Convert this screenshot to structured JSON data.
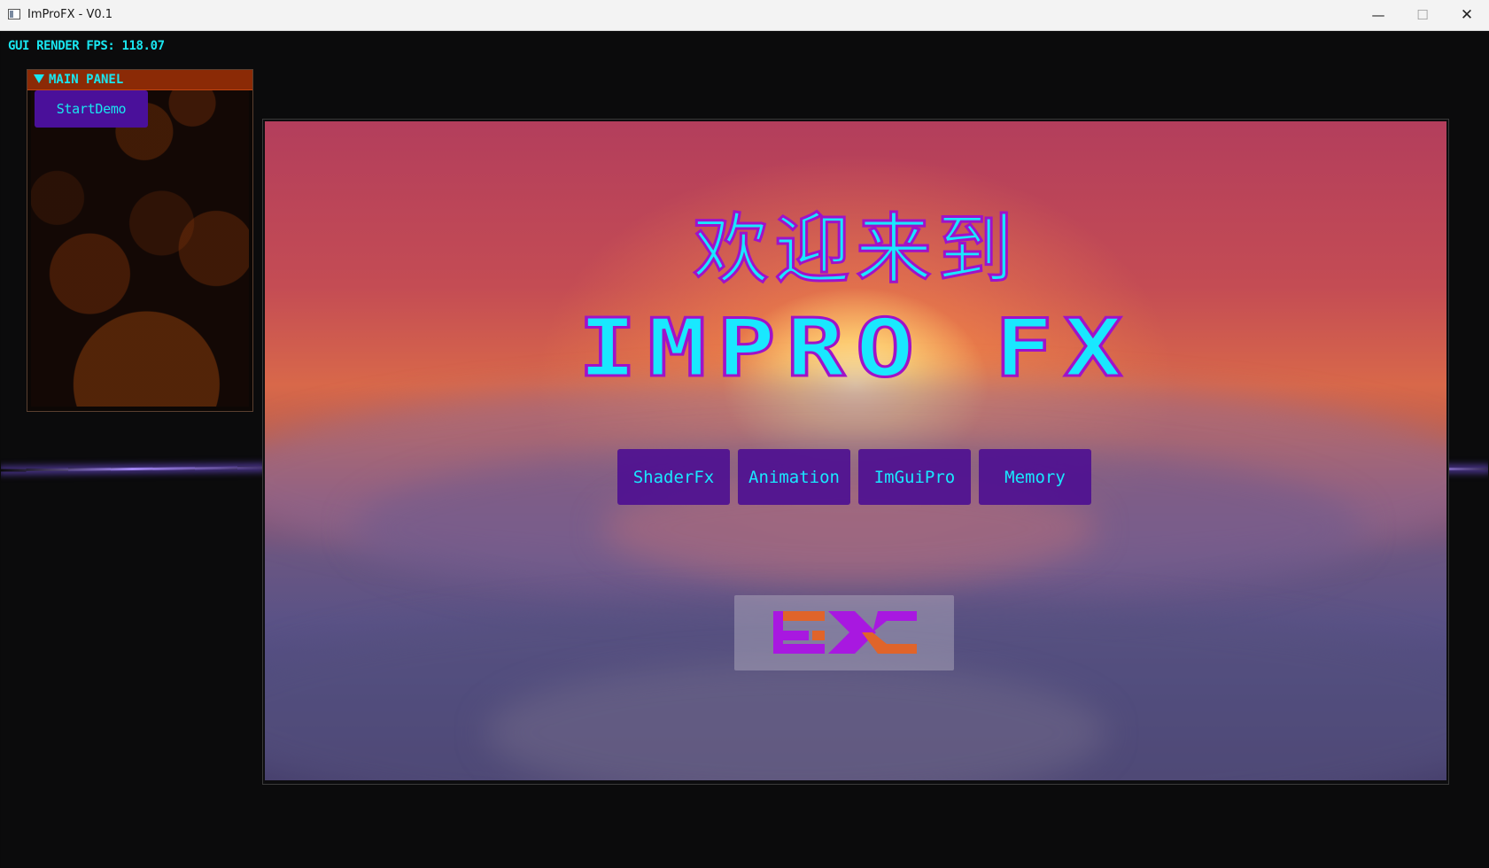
{
  "window": {
    "title": "ImProFX - V0.1",
    "minimize_label": "—",
    "maximize_label": "☐",
    "close_label": "✕"
  },
  "overlay": {
    "fps_text": "GUI RENDER FPS: 118.07"
  },
  "main_panel": {
    "title": "MAIN PANEL",
    "start_button_label": "StartDemo"
  },
  "viewport": {
    "welcome_text": "欢迎来到",
    "logo_text": "IMPRO FX",
    "nav_buttons": [
      {
        "label": "ShaderFx"
      },
      {
        "label": "Animation"
      },
      {
        "label": "ImGuiPro"
      },
      {
        "label": "Memory"
      }
    ],
    "fx_logo_text": "FX"
  },
  "colors": {
    "accent_cyan": "#19e6f0",
    "button_purple": "#4a109a",
    "panel_header": "#8b2a06",
    "logo_outline": "#a012c8",
    "fx_orange": "#e0642a",
    "fx_purple": "#a818e0"
  }
}
